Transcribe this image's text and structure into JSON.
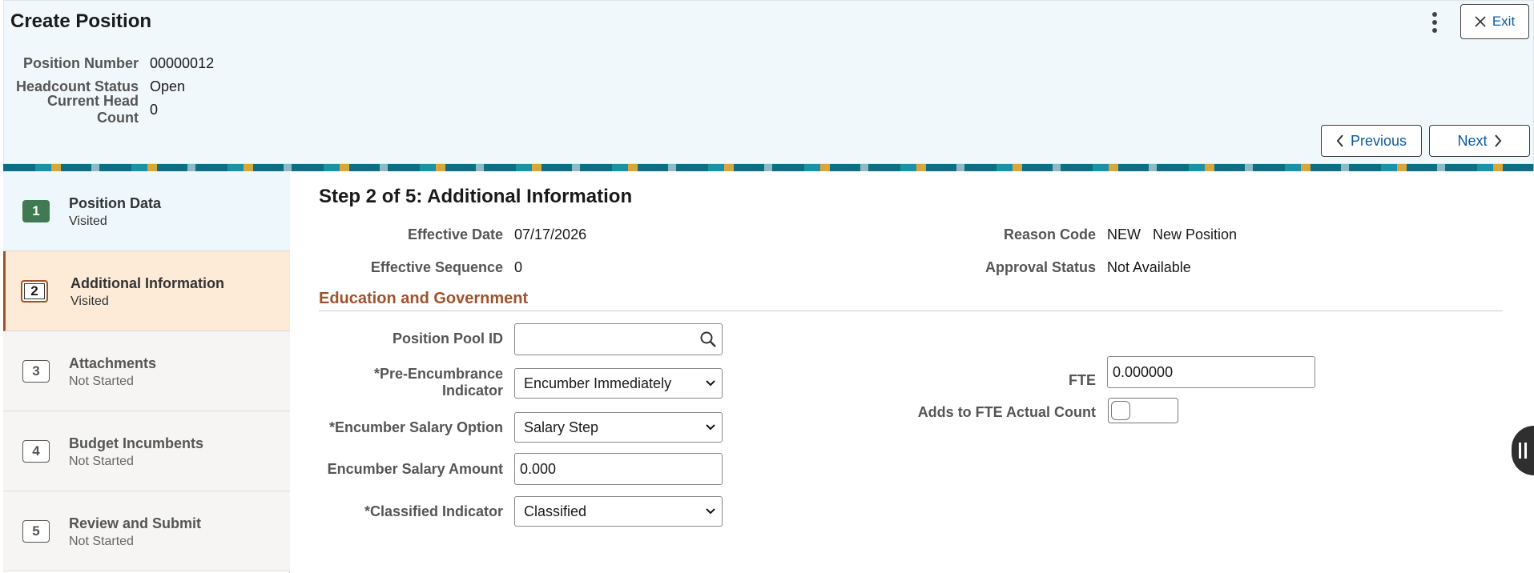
{
  "header": {
    "title": "Create Position",
    "exit_label": "Exit",
    "previous_label": "Previous",
    "next_label": "Next",
    "info": [
      {
        "label": "Position Number",
        "value": "00000012"
      },
      {
        "label": "Headcount Status",
        "value": "Open"
      },
      {
        "label": "Current Head Count",
        "value": "0"
      }
    ]
  },
  "steps": [
    {
      "num": "1",
      "title": "Position Data",
      "status": "Visited"
    },
    {
      "num": "2",
      "title": "Additional Information",
      "status": "Visited"
    },
    {
      "num": "3",
      "title": "Attachments",
      "status": "Not Started"
    },
    {
      "num": "4",
      "title": "Budget Incumbents",
      "status": "Not Started"
    },
    {
      "num": "5",
      "title": "Review and Submit",
      "status": "Not Started"
    }
  ],
  "main": {
    "heading": "Step 2 of 5: Additional Information",
    "effective_date_label": "Effective Date",
    "effective_date": "07/17/2026",
    "effective_sequence_label": "Effective Sequence",
    "effective_sequence": "0",
    "reason_code_label": "Reason Code",
    "reason_code": "NEW",
    "reason_desc": "New Position",
    "approval_status_label": "Approval Status",
    "approval_status": "Not Available",
    "section_title": "Education and Government",
    "position_pool_label": "Position Pool ID",
    "position_pool_value": "",
    "pre_enc_label_1": "*Pre-Encumbrance",
    "pre_enc_label_2": "Indicator",
    "pre_enc_value": "Encumber Immediately",
    "enc_salary_option_label": "*Encumber Salary Option",
    "enc_salary_option_value": "Salary Step",
    "enc_salary_amount_label": "Encumber Salary Amount",
    "enc_salary_amount_value": "0.000",
    "classified_label": "*Classified Indicator",
    "classified_value": "Classified",
    "fte_label": "FTE",
    "fte_value": "0.000000",
    "adds_fte_label": "Adds to FTE Actual Count",
    "adds_fte_checked": false
  }
}
